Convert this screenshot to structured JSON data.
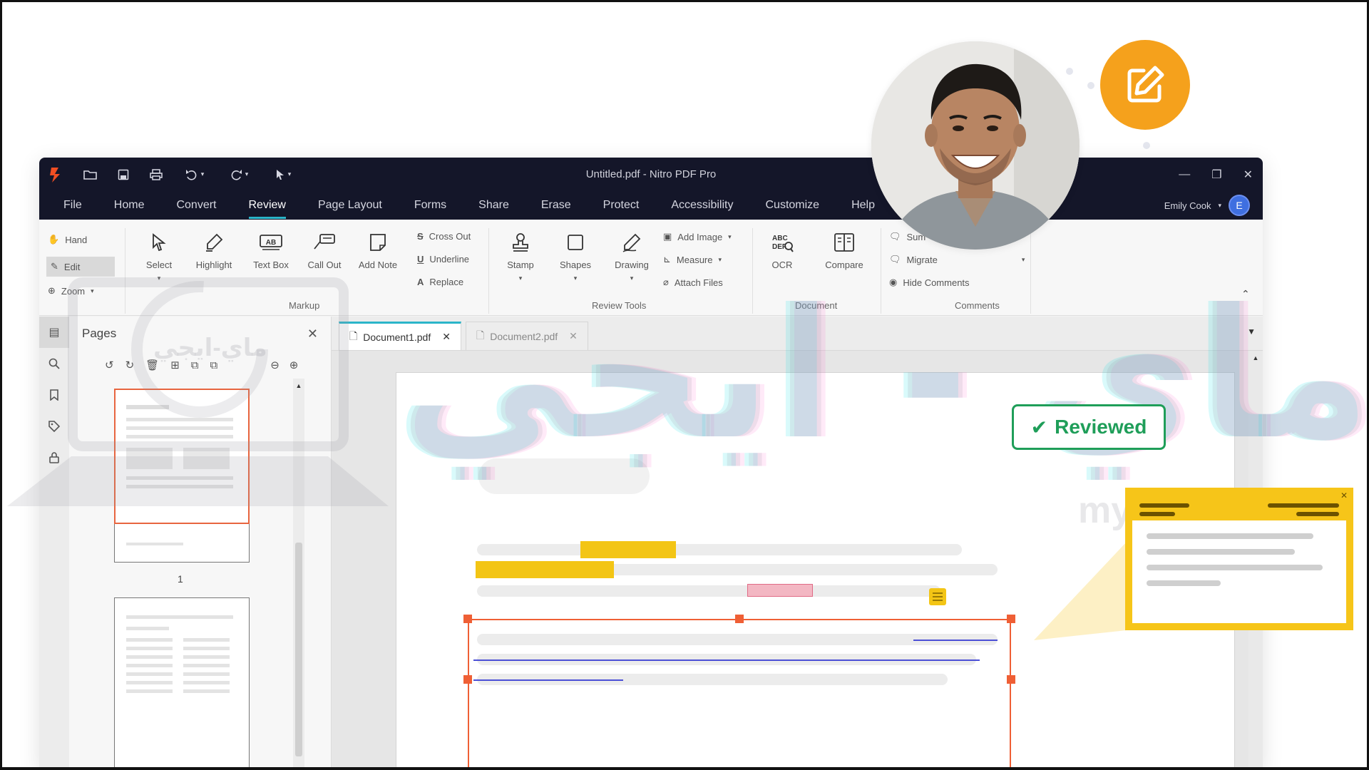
{
  "window": {
    "title": "Untitled.pdf - Nitro PDF Pro",
    "minimize_icon": "minimize-icon",
    "restore_icon": "restore-icon",
    "close_icon": "close-icon"
  },
  "quick_access": [
    "open-folder-icon",
    "save-icon",
    "print-icon",
    "undo-icon",
    "redo-icon",
    "pointer-icon"
  ],
  "menu": {
    "items": [
      "File",
      "Home",
      "Convert",
      "Review",
      "Page Layout",
      "Forms",
      "Share",
      "Erase",
      "Protect",
      "Accessibility",
      "Customize",
      "Help"
    ],
    "active": "Review"
  },
  "user": {
    "name": "Emily Cook",
    "initial": "E"
  },
  "ribbon": {
    "hand": "Hand",
    "edit": "Edit",
    "zoom": "Zoom",
    "select": "Select",
    "highlight": "Highlight",
    "text_box": "Text Box",
    "call_out": "Call Out",
    "add_note": "Add Note",
    "cross_out": "Cross Out",
    "underline": "Underline",
    "replace": "Replace",
    "stamp": "Stamp",
    "shapes": "Shapes",
    "drawing": "Drawing",
    "add_image": "Add Image",
    "measure": "Measure",
    "attach_files": "Attach Files",
    "ocr": "OCR",
    "compare": "Compare",
    "summarize": "Sum",
    "migrate": "Migrate",
    "hide_comments": "Hide Comments",
    "groups": {
      "markup": "Markup",
      "review_tools": "Review Tools",
      "document": "Document",
      "comments": "Comments"
    }
  },
  "pages_panel": {
    "title": "Pages",
    "page_number": "1"
  },
  "tabs": [
    {
      "label": "Document1.pdf",
      "active": true
    },
    {
      "label": "Document2.pdf",
      "active": false
    }
  ],
  "stamp": {
    "label": "Reviewed",
    "color": "#1f9e59"
  },
  "colors": {
    "titlebar": "#141629",
    "accent": "#2bb5c9",
    "highlight": "#f3c515",
    "selection": "#ef5f35",
    "edit_badge": "#f5a11c"
  },
  "watermark": {
    "arabic": "ماي - ايجي",
    "latin": "my-egy.online",
    "logo_text": "ماي-ايجي"
  }
}
